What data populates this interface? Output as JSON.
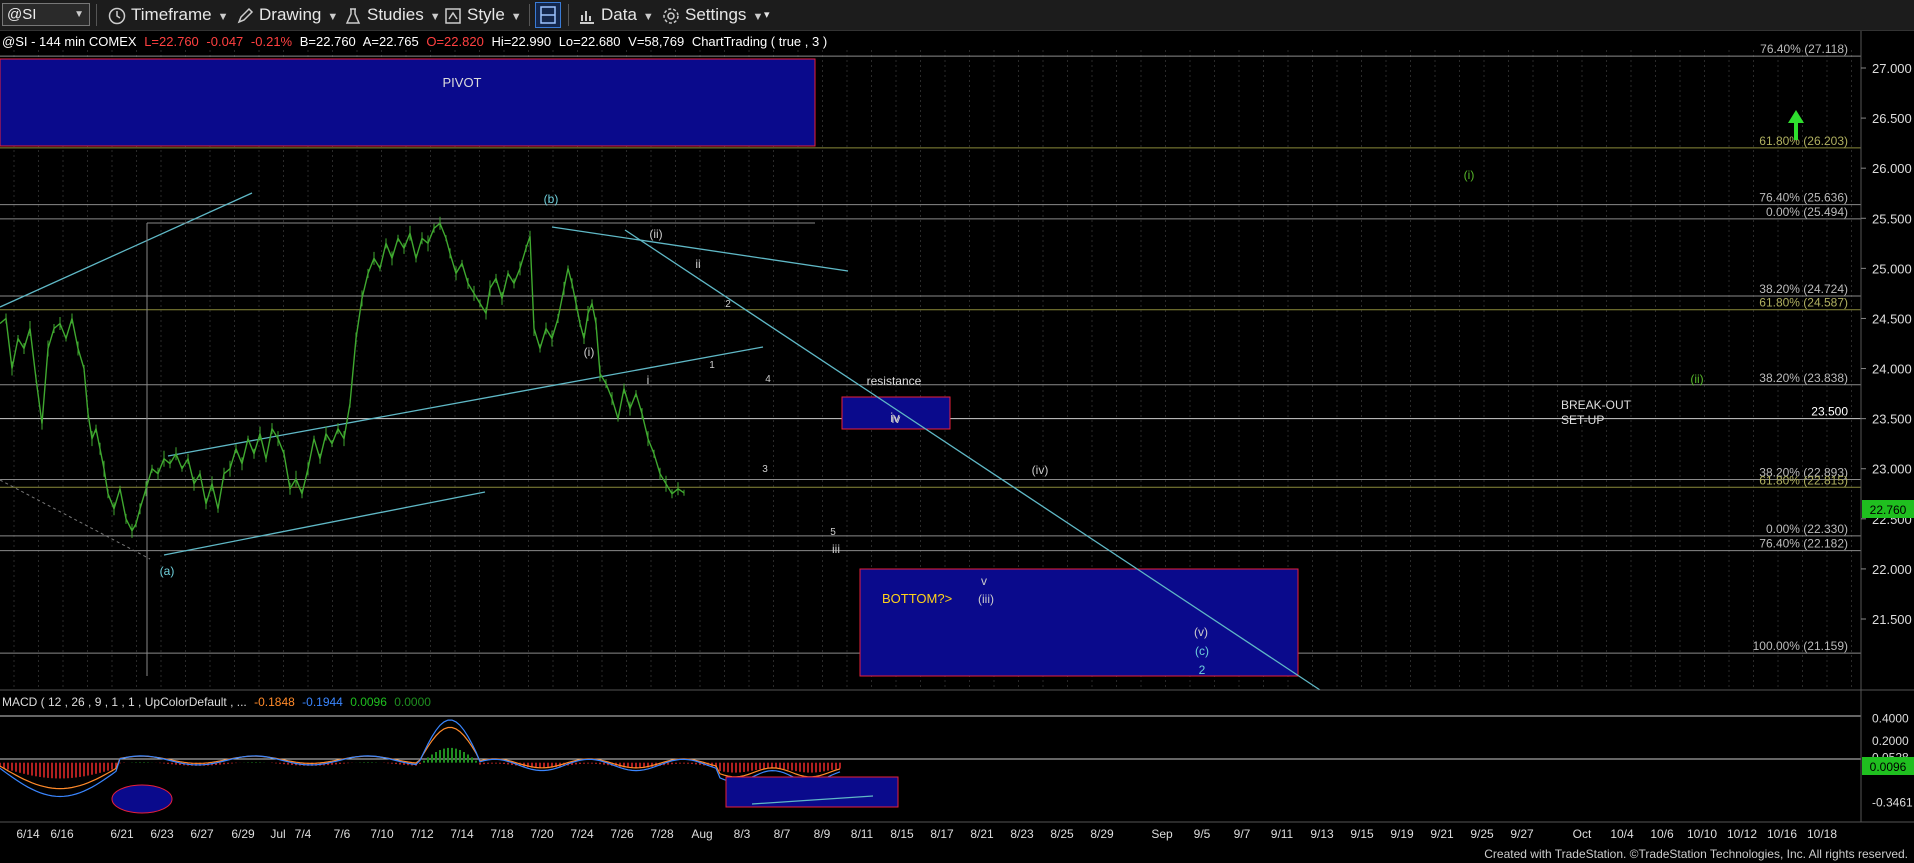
{
  "toolbar": {
    "symbol": "@SI",
    "timeframe": "Timeframe",
    "drawing": "Drawing",
    "studies": "Studies",
    "style": "Style",
    "data": "Data",
    "settings": "Settings"
  },
  "header": {
    "symbol_info": "@SI - 144 min  COMEX",
    "last": "L=22.760",
    "change": "-0.047",
    "change_pct": "-0.21%",
    "bid": "B=22.760",
    "ask": "A=22.765",
    "open": "O=22.820",
    "high": "Hi=22.990",
    "low": "Lo=22.680",
    "volume": "V=58,769",
    "study": "ChartTrading ( true , 3 )"
  },
  "macd_header": {
    "label": "MACD ( 12 , 26 , 9 , 1 , 1 , UpColorDefault , ...",
    "v1": "-0.1848",
    "v2": "-0.1944",
    "v3": "0.0096",
    "v4": "0.0000"
  },
  "footer": "Created with TradeStation. ©TradeStation Technologies, Inc. All rights reserved.",
  "colors": {
    "price_up": "#3fa82f",
    "box_fill": "#0a0a8c",
    "box_border": "#e8203a",
    "trendline": "#5fb8c6",
    "fib_grey": "#8a8a8a",
    "fib_olive": "#8a8a3a",
    "label_teal": "#6fd0dc",
    "label_green": "#57b82a",
    "label_yellow": "#ffd21a",
    "macd_line": "#3a86ff",
    "signal_line": "#ff8a2a",
    "hist_up": "#1f8f1f",
    "hist_down": "#b02020"
  },
  "chart_data": {
    "type": "candlestick",
    "title": "@SI - 144 min COMEX",
    "price_axis": {
      "min": 21.0,
      "max": 27.2,
      "ticks": [
        "27.000",
        "26.500",
        "26.000",
        "25.500",
        "25.000",
        "24.500",
        "24.000",
        "23.500",
        "23.000",
        "22.500",
        "22.000",
        "21.500"
      ],
      "last_price": "22.760"
    },
    "x_labels": [
      "6/14",
      "6/16",
      "6/21",
      "6/23",
      "6/27",
      "6/29",
      "Jul",
      "7/4",
      "7/6",
      "7/10",
      "7/12",
      "7/14",
      "7/18",
      "7/20",
      "7/24",
      "7/26",
      "7/28",
      "Aug",
      "8/3",
      "8/7",
      "8/9",
      "8/11",
      "8/15",
      "8/17",
      "8/21",
      "8/23",
      "8/25",
      "8/29",
      "Sep",
      "9/5",
      "9/7",
      "9/11",
      "9/13",
      "9/15",
      "9/19",
      "9/21",
      "9/25",
      "9/27",
      "Oct",
      "10/4",
      "10/6",
      "10/10",
      "10/12",
      "10/16",
      "10/18"
    ],
    "price_path": [
      [
        0,
        24.45
      ],
      [
        6,
        24.5
      ],
      [
        12,
        24.0
      ],
      [
        18,
        24.3
      ],
      [
        24,
        24.2
      ],
      [
        30,
        24.4
      ],
      [
        36,
        23.9
      ],
      [
        42,
        23.45
      ],
      [
        48,
        24.2
      ],
      [
        54,
        24.4
      ],
      [
        60,
        24.45
      ],
      [
        66,
        24.3
      ],
      [
        72,
        24.5
      ],
      [
        78,
        24.2
      ],
      [
        84,
        24.0
      ],
      [
        88,
        23.55
      ],
      [
        92,
        23.3
      ],
      [
        96,
        23.4
      ],
      [
        100,
        23.2
      ],
      [
        104,
        23.0
      ],
      [
        108,
        22.75
      ],
      [
        114,
        22.6
      ],
      [
        120,
        22.8
      ],
      [
        126,
        22.5
      ],
      [
        132,
        22.38
      ],
      [
        136,
        22.45
      ],
      [
        140,
        22.6
      ],
      [
        146,
        22.8
      ],
      [
        152,
        23.0
      ],
      [
        158,
        22.95
      ],
      [
        164,
        23.1
      ],
      [
        170,
        23.05
      ],
      [
        176,
        23.15
      ],
      [
        182,
        23.0
      ],
      [
        188,
        23.1
      ],
      [
        194,
        22.85
      ],
      [
        200,
        22.95
      ],
      [
        206,
        22.65
      ],
      [
        212,
        22.85
      ],
      [
        218,
        22.6
      ],
      [
        224,
        22.95
      ],
      [
        230,
        23.0
      ],
      [
        236,
        23.2
      ],
      [
        242,
        23.05
      ],
      [
        248,
        23.3
      ],
      [
        254,
        23.15
      ],
      [
        260,
        23.35
      ],
      [
        266,
        23.1
      ],
      [
        272,
        23.4
      ],
      [
        278,
        23.3
      ],
      [
        284,
        23.15
      ],
      [
        290,
        22.8
      ],
      [
        296,
        22.9
      ],
      [
        302,
        22.75
      ],
      [
        308,
        23.0
      ],
      [
        314,
        23.3
      ],
      [
        320,
        23.1
      ],
      [
        326,
        23.35
      ],
      [
        332,
        23.25
      ],
      [
        338,
        23.4
      ],
      [
        344,
        23.3
      ],
      [
        350,
        23.65
      ],
      [
        356,
        24.3
      ],
      [
        362,
        24.7
      ],
      [
        368,
        24.95
      ],
      [
        374,
        25.1
      ],
      [
        380,
        25.0
      ],
      [
        386,
        25.25
      ],
      [
        392,
        25.1
      ],
      [
        398,
        25.3
      ],
      [
        404,
        25.2
      ],
      [
        410,
        25.35
      ],
      [
        416,
        25.1
      ],
      [
        422,
        25.3
      ],
      [
        428,
        25.25
      ],
      [
        434,
        25.4
      ],
      [
        440,
        25.45
      ],
      [
        446,
        25.3
      ],
      [
        450,
        25.15
      ],
      [
        456,
        24.95
      ],
      [
        462,
        25.05
      ],
      [
        468,
        24.85
      ],
      [
        474,
        24.75
      ],
      [
        480,
        24.65
      ],
      [
        486,
        24.55
      ],
      [
        490,
        24.8
      ],
      [
        496,
        24.9
      ],
      [
        502,
        24.7
      ],
      [
        508,
        24.95
      ],
      [
        514,
        24.85
      ],
      [
        520,
        25.0
      ],
      [
        526,
        25.2
      ],
      [
        530,
        25.32
      ],
      [
        534,
        24.4
      ],
      [
        540,
        24.2
      ],
      [
        546,
        24.4
      ],
      [
        552,
        24.3
      ],
      [
        558,
        24.5
      ],
      [
        564,
        24.8
      ],
      [
        568,
        25.0
      ],
      [
        572,
        24.85
      ],
      [
        576,
        24.65
      ],
      [
        580,
        24.45
      ],
      [
        584,
        24.3
      ],
      [
        588,
        24.55
      ],
      [
        592,
        24.65
      ],
      [
        596,
        24.45
      ],
      [
        600,
        23.95
      ],
      [
        606,
        23.85
      ],
      [
        612,
        23.7
      ],
      [
        618,
        23.5
      ],
      [
        624,
        23.8
      ],
      [
        630,
        23.6
      ],
      [
        636,
        23.75
      ],
      [
        642,
        23.55
      ],
      [
        648,
        23.3
      ],
      [
        654,
        23.15
      ],
      [
        660,
        22.95
      ],
      [
        666,
        22.85
      ],
      [
        672,
        22.75
      ],
      [
        678,
        22.8
      ],
      [
        684,
        22.76
      ]
    ],
    "fib_levels": [
      {
        "label": "76.40% (27.118)",
        "value": 27.118,
        "color": "grey"
      },
      {
        "label": "61.80% (26.203)",
        "value": 26.203,
        "color": "olive"
      },
      {
        "label": "76.40% (25.636)",
        "value": 25.636,
        "color": "grey"
      },
      {
        "label": "0.00% (25.494)",
        "value": 25.494,
        "color": "grey"
      },
      {
        "label": "38.20% (24.724)",
        "value": 24.724,
        "color": "grey"
      },
      {
        "label": "61.80% (24.587)",
        "value": 24.587,
        "color": "olive"
      },
      {
        "label": "38.20% (23.838)",
        "value": 23.838,
        "color": "grey"
      },
      {
        "label": "23.500",
        "value": 23.5,
        "color": "white"
      },
      {
        "label": "38.20% (22.893)",
        "value": 22.893,
        "color": "grey"
      },
      {
        "label": "61.80% (22.815)",
        "value": 22.815,
        "color": "olive"
      },
      {
        "label": "0.00% (22.330)",
        "value": 22.33,
        "color": "grey"
      },
      {
        "label": "76.40% (22.182)",
        "value": 22.182,
        "color": "grey"
      },
      {
        "label": "100.00% (21.159)",
        "value": 21.159,
        "color": "grey"
      }
    ],
    "boxes": [
      {
        "label": "PIVOT",
        "price_top": 27.2,
        "price_bottom": 26.25
      },
      {
        "label": "iv",
        "price_top": 23.85,
        "price_bottom": 23.53
      },
      {
        "label": "BOTTOM?>",
        "price_top": 22.18,
        "price_bottom": 21.16
      }
    ],
    "wave_labels": [
      "(a)",
      "(b)",
      "(i)",
      "(ii)",
      "i",
      "ii",
      "1",
      "2",
      "3",
      "4",
      "5",
      "iii",
      "iv",
      "v",
      "(iii)",
      "(iv)",
      "(v)",
      "(c)",
      "2",
      "(i)",
      "(ii)",
      "resistance",
      "BREAK-OUT",
      "SET-UP"
    ],
    "macd": {
      "ticks": [
        "0.4000",
        "0.2000",
        "0.0528",
        "0.0096",
        "-0.3461"
      ],
      "min": -0.42,
      "max": 0.45
    }
  }
}
